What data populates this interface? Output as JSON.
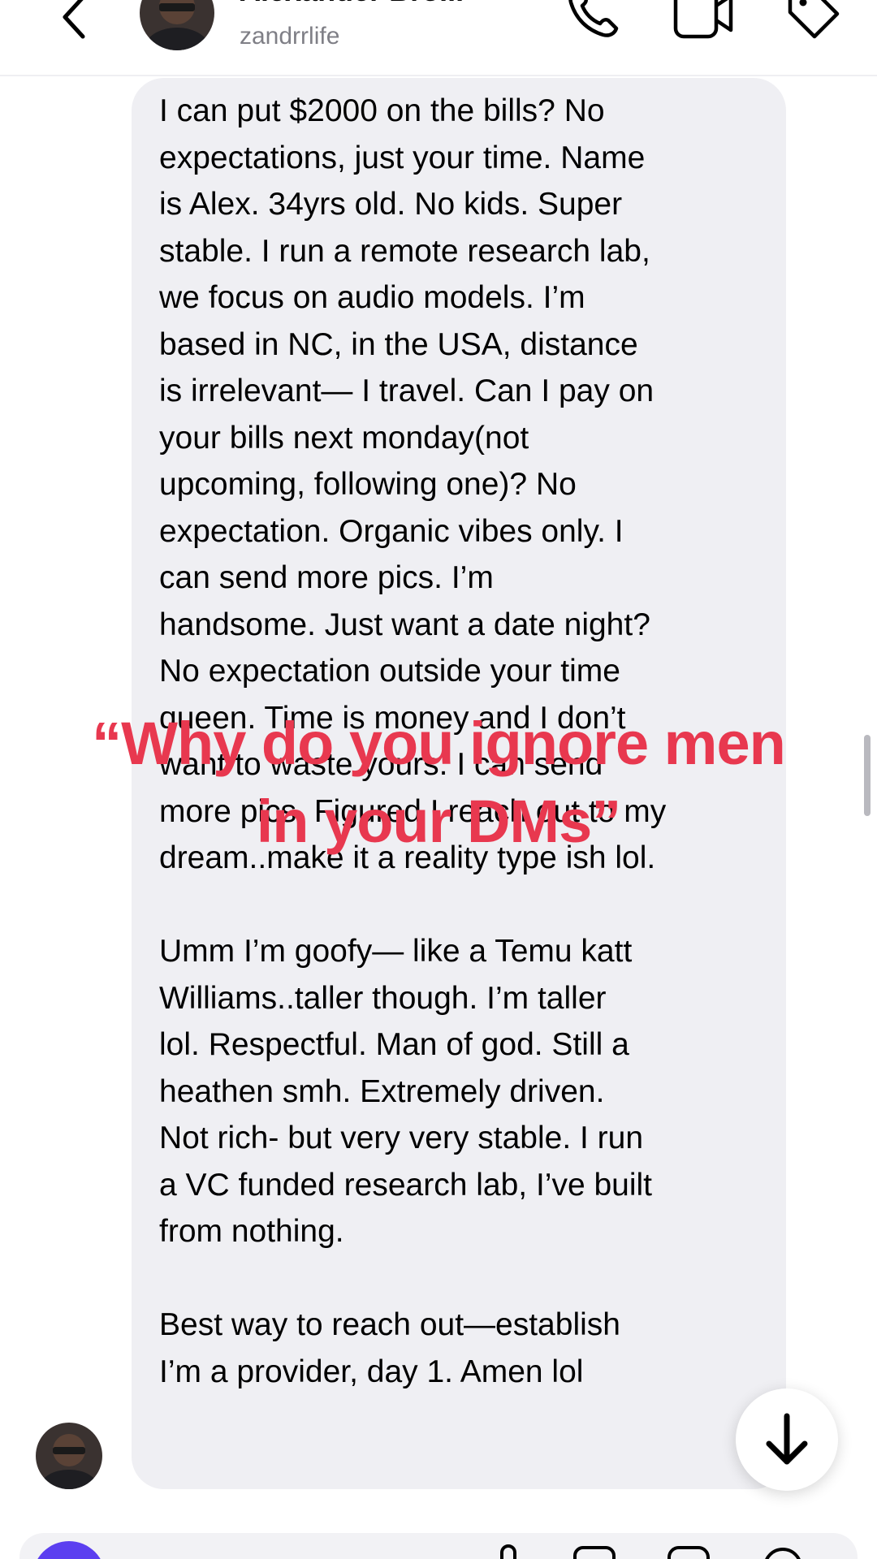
{
  "header": {
    "name": "Alexander Bro...",
    "username": "zandrrlife",
    "icons": [
      "back-chevron-icon",
      "phone-icon",
      "video-icon",
      "tag-icon"
    ]
  },
  "message": {
    "text": "I can put $2000 on the bills? No\nexpectations, just your time. Name\nis Alex. 34yrs old. No kids. Super\nstable. I run a remote research lab,\nwe focus on audio models. I’m\nbased in NC, in the USA, distance\nis irrelevant— I travel. Can I pay on\nyour bills next monday(not\nupcoming, following one)? No\nexpectation. Organic vibes only. I\ncan send more pics. I’m\nhandsome. Just want a date night?\nNo expectation outside your time\nqueen. Time is money and I don’t\nwant to waste yours. I can send\nmore pics. Figured I reach out to my\ndream..make it a reality type ish lol.\n\nUmm I’m goofy— like a Temu katt\nWilliams..taller though. I’m taller\nlol. Respectful. Man of god. Still a\nheathen smh. Extremely driven.\nNot rich- but very very stable. I run\na VC funded research lab, I’ve built\nfrom nothing.\n\nBest way to reach out—establish\nI’m a provider, day 1. Amen lol"
  },
  "overlay": {
    "caption": "“Why do you ignore men\nin your DMs”",
    "color": "#e8384f"
  },
  "colors": {
    "bubble": "#efeff3",
    "camera_button": "#5b3ff0",
    "secondary_text": "#7f7f86"
  },
  "icons": {
    "scroll_down": "arrow-down-icon",
    "composer": [
      "camera-icon",
      "mic-icon",
      "gallery-icon",
      "sticker-icon",
      "heart-icon"
    ]
  }
}
